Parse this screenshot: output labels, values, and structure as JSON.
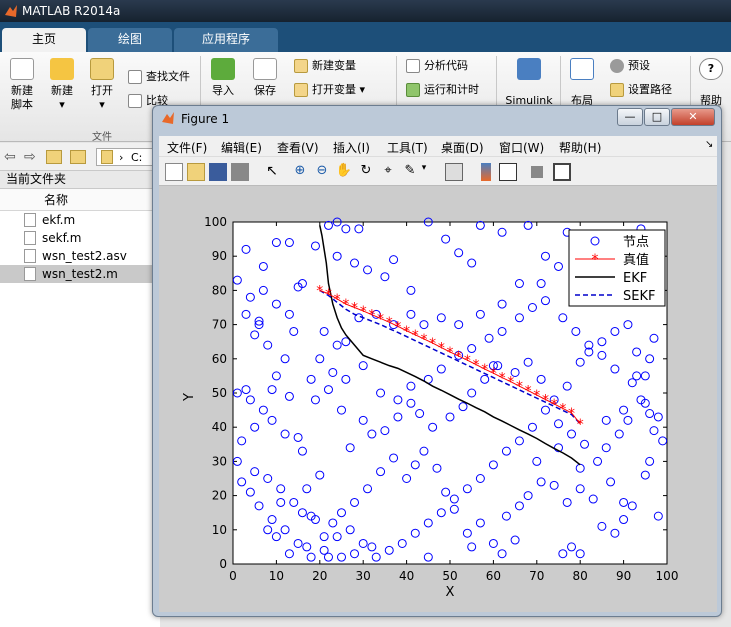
{
  "window": {
    "title": "MATLAB R2014a"
  },
  "tabs": [
    {
      "label": "主页",
      "active": true
    },
    {
      "label": "绘图",
      "active": false
    },
    {
      "label": "应用程序",
      "active": false
    }
  ],
  "ribbon": {
    "new_script": "新建\n脚本",
    "new": "新建",
    "open": "打开",
    "find_files": "查找文件",
    "compare": "比较",
    "import": "导入",
    "save": "保存",
    "new_variable": "新建变量",
    "open_variable": "打开变量",
    "analyze_code": "分析代码",
    "run_and_time": "运行和计时",
    "simulink": "Simulink",
    "layout": "布局",
    "preferences": "预设",
    "set_path": "设置路径",
    "help": "帮助",
    "section_file": "文件"
  },
  "address": {
    "path": "C:"
  },
  "current_folder": {
    "title": "当前文件夹",
    "column_name": "名称",
    "files": [
      {
        "name": "ekf.m",
        "selected": false
      },
      {
        "name": "sekf.m",
        "selected": false
      },
      {
        "name": "wsn_test2.asv",
        "selected": false
      },
      {
        "name": "wsn_test2.m",
        "selected": true
      }
    ]
  },
  "figure": {
    "title": "Figure 1",
    "menu": [
      "文件(F)",
      "编辑(E)",
      "查看(V)",
      "插入(I)",
      "工具(T)",
      "桌面(D)",
      "窗口(W)",
      "帮助(H)"
    ]
  },
  "chart_data": {
    "type": "scatter",
    "xlabel": "X",
    "ylabel": "Y",
    "xlim": [
      0,
      100
    ],
    "ylim": [
      0,
      100
    ],
    "xticks": [
      0,
      10,
      20,
      30,
      40,
      50,
      60,
      70,
      80,
      90,
      100
    ],
    "yticks": [
      0,
      10,
      20,
      30,
      40,
      50,
      60,
      70,
      80,
      90,
      100
    ],
    "legend_position": "top-right",
    "series": [
      {
        "name": "节点",
        "kind": "markers",
        "marker": "o",
        "color": "#0000ff",
        "points": [
          [
            1,
            83
          ],
          [
            3,
            92
          ],
          [
            6,
            71
          ],
          [
            7,
            87
          ],
          [
            10,
            94
          ],
          [
            13,
            94
          ],
          [
            16,
            82
          ],
          [
            19,
            93
          ],
          [
            22,
            99
          ],
          [
            24,
            100
          ],
          [
            26,
            98
          ],
          [
            29,
            98
          ],
          [
            24,
            90
          ],
          [
            28,
            88
          ],
          [
            31,
            86
          ],
          [
            35,
            84
          ],
          [
            37,
            89
          ],
          [
            41,
            80
          ],
          [
            45,
            100
          ],
          [
            49,
            95
          ],
          [
            52,
            91
          ],
          [
            55,
            88
          ],
          [
            57,
            99
          ],
          [
            62,
            97
          ],
          [
            68,
            99
          ],
          [
            72,
            90
          ],
          [
            77,
            97
          ],
          [
            82,
            92
          ],
          [
            88,
            90
          ],
          [
            91,
            93
          ],
          [
            94,
            98
          ],
          [
            97,
            82
          ],
          [
            93,
            80
          ],
          [
            87,
            78
          ],
          [
            83,
            80
          ],
          [
            79,
            80
          ],
          [
            75,
            87
          ],
          [
            71,
            82
          ],
          [
            66,
            82
          ],
          [
            62,
            76
          ],
          [
            57,
            73
          ],
          [
            52,
            70
          ],
          [
            48,
            72
          ],
          [
            44,
            70
          ],
          [
            41,
            73
          ],
          [
            37,
            70
          ],
          [
            33,
            73
          ],
          [
            29,
            72
          ],
          [
            26,
            65
          ],
          [
            24,
            64
          ],
          [
            21,
            68
          ],
          [
            14,
            68
          ],
          [
            15,
            81
          ],
          [
            6,
            70
          ],
          [
            1,
            50
          ],
          [
            3,
            51
          ],
          [
            4,
            48
          ],
          [
            9,
            51
          ],
          [
            13,
            49
          ],
          [
            15,
            37
          ],
          [
            16,
            33
          ],
          [
            12,
            38
          ],
          [
            9,
            42
          ],
          [
            5,
            27
          ],
          [
            8,
            25
          ],
          [
            11,
            22
          ],
          [
            14,
            18
          ],
          [
            17,
            22
          ],
          [
            20,
            26
          ],
          [
            16,
            15
          ],
          [
            19,
            13
          ],
          [
            11,
            18
          ],
          [
            8,
            10
          ],
          [
            10,
            8
          ],
          [
            13,
            3
          ],
          [
            17,
            5
          ],
          [
            21,
            8
          ],
          [
            23,
            12
          ],
          [
            25,
            15
          ],
          [
            28,
            18
          ],
          [
            31,
            22
          ],
          [
            34,
            27
          ],
          [
            37,
            31
          ],
          [
            40,
            25
          ],
          [
            42,
            29
          ],
          [
            44,
            33
          ],
          [
            47,
            28
          ],
          [
            49,
            21
          ],
          [
            51,
            16
          ],
          [
            54,
            9
          ],
          [
            57,
            12
          ],
          [
            60,
            6
          ],
          [
            63,
            14
          ],
          [
            66,
            17
          ],
          [
            68,
            20
          ],
          [
            71,
            24
          ],
          [
            74,
            23
          ],
          [
            77,
            18
          ],
          [
            80,
            22
          ],
          [
            83,
            19
          ],
          [
            85,
            11
          ],
          [
            88,
            9
          ],
          [
            90,
            13
          ],
          [
            92,
            17
          ],
          [
            95,
            26
          ],
          [
            96,
            30
          ],
          [
            98,
            43
          ],
          [
            95,
            47
          ],
          [
            93,
            55
          ],
          [
            96,
            60
          ],
          [
            93,
            62
          ],
          [
            97,
            66
          ],
          [
            91,
            70
          ],
          [
            88,
            68
          ],
          [
            85,
            65
          ],
          [
            82,
            62
          ],
          [
            80,
            59
          ],
          [
            77,
            52
          ],
          [
            74,
            48
          ],
          [
            71,
            54
          ],
          [
            68,
            59
          ],
          [
            65,
            56
          ],
          [
            61,
            58
          ],
          [
            58,
            54
          ],
          [
            55,
            50
          ],
          [
            53,
            46
          ],
          [
            50,
            43
          ],
          [
            46,
            40
          ],
          [
            43,
            44
          ],
          [
            41,
            47
          ],
          [
            38,
            43
          ],
          [
            35,
            39
          ],
          [
            32,
            38
          ],
          [
            30,
            42
          ],
          [
            27,
            34
          ],
          [
            25,
            45
          ],
          [
            22,
            51
          ],
          [
            19,
            48
          ],
          [
            18,
            54
          ],
          [
            20,
            60
          ],
          [
            23,
            56
          ],
          [
            26,
            54
          ],
          [
            30,
            58
          ],
          [
            34,
            50
          ],
          [
            38,
            48
          ],
          [
            41,
            52
          ],
          [
            45,
            54
          ],
          [
            48,
            57
          ],
          [
            52,
            61
          ],
          [
            55,
            63
          ],
          [
            59,
            66
          ],
          [
            62,
            68
          ],
          [
            66,
            72
          ],
          [
            69,
            75
          ],
          [
            72,
            77
          ],
          [
            76,
            72
          ],
          [
            79,
            68
          ],
          [
            82,
            64
          ],
          [
            85,
            61
          ],
          [
            88,
            57
          ],
          [
            92,
            53
          ],
          [
            94,
            48
          ],
          [
            96,
            44
          ],
          [
            91,
            42
          ],
          [
            89,
            38
          ],
          [
            86,
            34
          ],
          [
            84,
            30
          ],
          [
            81,
            35
          ],
          [
            78,
            38
          ],
          [
            75,
            41
          ],
          [
            72,
            45
          ],
          [
            69,
            40
          ],
          [
            66,
            36
          ],
          [
            63,
            33
          ],
          [
            60,
            29
          ],
          [
            57,
            25
          ],
          [
            54,
            22
          ],
          [
            51,
            19
          ],
          [
            48,
            15
          ],
          [
            45,
            12
          ],
          [
            42,
            9
          ],
          [
            39,
            6
          ],
          [
            36,
            4
          ],
          [
            33,
            2
          ],
          [
            30,
            6
          ],
          [
            27,
            10
          ],
          [
            24,
            8
          ],
          [
            21,
            4
          ],
          [
            18,
            2
          ],
          [
            15,
            6
          ],
          [
            12,
            10
          ],
          [
            9,
            13
          ],
          [
            6,
            17
          ],
          [
            4,
            21
          ],
          [
            2,
            24
          ],
          [
            1,
            30
          ],
          [
            2,
            36
          ],
          [
            5,
            40
          ],
          [
            7,
            45
          ],
          [
            10,
            55
          ],
          [
            12,
            60
          ],
          [
            8,
            64
          ],
          [
            5,
            67
          ],
          [
            3,
            73
          ],
          [
            4,
            78
          ],
          [
            7,
            80
          ],
          [
            10,
            76
          ],
          [
            13,
            73
          ],
          [
            60,
            58
          ],
          [
            70,
            30
          ],
          [
            75,
            34
          ],
          [
            80,
            28
          ],
          [
            86,
            42
          ],
          [
            90,
            45
          ],
          [
            97,
            39
          ],
          [
            95,
            55
          ],
          [
            99,
            36
          ],
          [
            98,
            14
          ],
          [
            90,
            18
          ],
          [
            87,
            24
          ],
          [
            76,
            3
          ],
          [
            80,
            3
          ],
          [
            78,
            5
          ],
          [
            62,
            3
          ],
          [
            65,
            7
          ],
          [
            55,
            5
          ],
          [
            45,
            2
          ],
          [
            32,
            5
          ],
          [
            28,
            3
          ],
          [
            25,
            2
          ],
          [
            22,
            2
          ],
          [
            18,
            14
          ]
        ]
      },
      {
        "name": "真值",
        "kind": "line-markers",
        "marker": "*",
        "color": "#ff0000",
        "x": [
          20,
          22,
          24,
          26,
          28,
          30,
          32,
          34,
          36,
          38,
          40,
          42,
          44,
          46,
          48,
          50,
          52,
          54,
          56,
          58,
          60,
          62,
          64,
          66,
          68,
          70,
          72,
          74,
          76,
          78,
          80
        ],
        "y": [
          80,
          79,
          77.5,
          76,
          75,
          74,
          72.9,
          71.8,
          70.7,
          69.5,
          68.2,
          67,
          65.8,
          64.6,
          63.3,
          62,
          60.8,
          59.6,
          58.3,
          57,
          55.8,
          54.5,
          53.3,
          52,
          50.7,
          49.4,
          48.1,
          46.8,
          45.5,
          44.2,
          41
        ]
      },
      {
        "name": "EKF",
        "kind": "line",
        "style": "solid",
        "color": "#000000",
        "x": [
          20,
          20.5,
          21,
          21.5,
          22,
          23,
          24,
          25,
          26,
          28,
          30,
          32,
          34,
          36,
          38,
          40,
          42,
          44,
          46,
          48,
          50,
          52,
          54,
          56,
          58,
          60,
          62,
          64,
          66,
          68,
          70,
          72,
          74,
          76,
          78,
          80
        ],
        "y": [
          99,
          96,
          92,
          88,
          82,
          76,
          72,
          69,
          67,
          64,
          61,
          60,
          59,
          58,
          57.2,
          56,
          54.8,
          53.5,
          52,
          50.8,
          49.5,
          48.2,
          47,
          45.7,
          44.5,
          43,
          41.8,
          40.5,
          39.2,
          38,
          36.7,
          35.2,
          33.8,
          32.5,
          31,
          29
        ]
      },
      {
        "name": "SEKF",
        "kind": "line",
        "style": "dashed",
        "color": "#0000cc",
        "x": [
          20,
          22,
          24,
          26,
          28,
          30,
          32,
          34,
          36,
          38,
          40,
          42,
          44,
          46,
          48,
          50,
          52,
          54,
          56,
          58,
          60,
          62,
          64,
          66,
          68,
          70,
          72,
          74,
          76,
          78,
          80
        ],
        "y": [
          80,
          78.5,
          76.5,
          74.5,
          73,
          72,
          71,
          70,
          68.8,
          67.7,
          66.5,
          65.3,
          64.1,
          62.9,
          61.7,
          60.5,
          59.3,
          58.1,
          56.9,
          55.7,
          54.5,
          53.3,
          52.1,
          50.9,
          49.7,
          48.5,
          47.3,
          46.1,
          44.9,
          43.7,
          41
        ]
      }
    ]
  }
}
